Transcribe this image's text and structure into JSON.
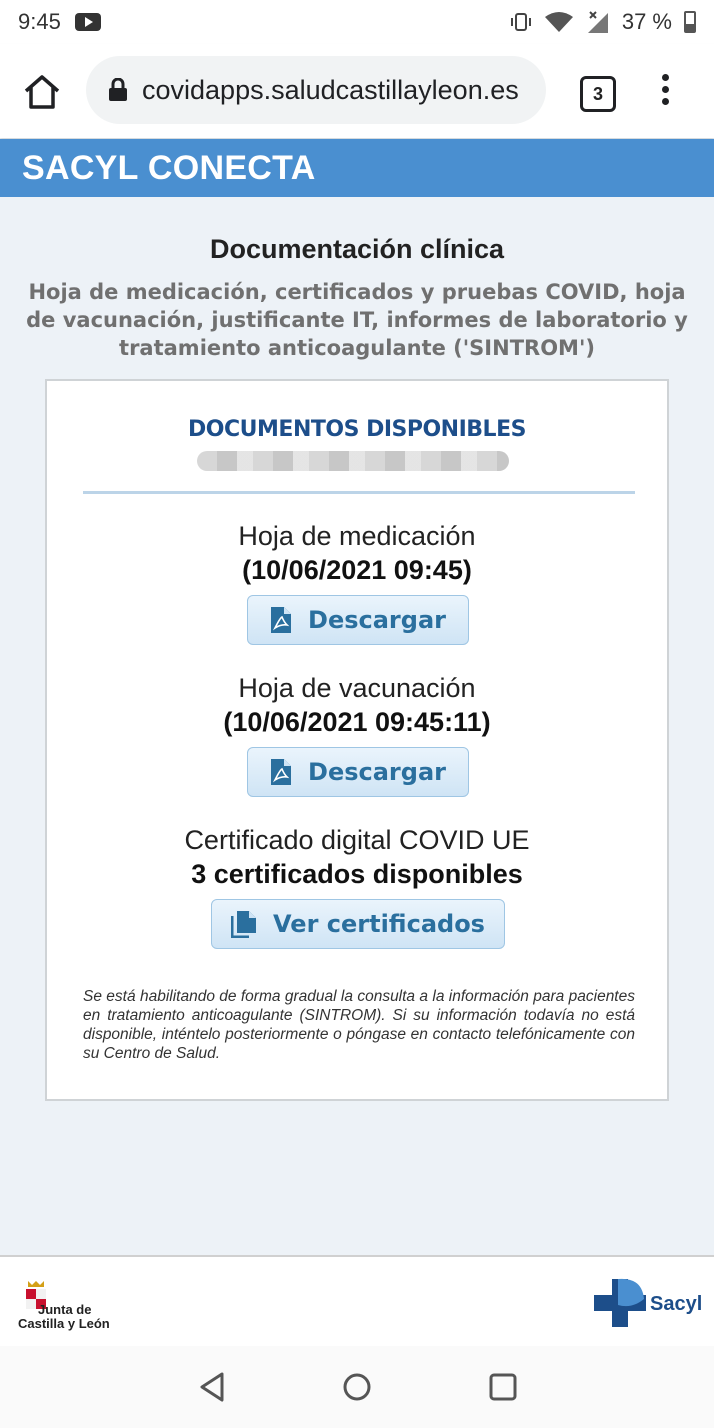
{
  "status_bar": {
    "time": "9:45",
    "battery": "37 %"
  },
  "browser": {
    "url": "covidapps.saludcastillayleon.es",
    "tab_count": "3"
  },
  "header": {
    "title": "SACYL CONECTA"
  },
  "page": {
    "title": "Documentación clínica",
    "subtitle": "Hoja de medicación, certificados y pruebas COVID, hoja de vacunación, justificante IT, informes de laboratorio y tratamiento anticoagulante ('SINTROM')"
  },
  "card": {
    "heading": "DOCUMENTOS DISPONIBLES",
    "items": [
      {
        "title": "Hoja de medicación",
        "detail": "(10/06/2021 09:45)",
        "button": "Descargar"
      },
      {
        "title": "Hoja de vacunación",
        "detail": "(10/06/2021 09:45:11)",
        "button": "Descargar"
      },
      {
        "title": "Certificado digital COVID UE",
        "detail": "3 certificados disponibles",
        "button": "Ver certificados"
      }
    ],
    "note": "Se está habilitando de forma gradual la consulta a la información para pacientes en tratamiento anticoagulante (SINTROM). Si su información todavía no está disponible, inténtelo posteriormente o póngase en contacto telefónicamente con su Centro de Salud."
  },
  "footer": {
    "left_logo": [
      "Junta de",
      "Castilla y León"
    ],
    "right_logo": "Sacyl"
  },
  "colors": {
    "header": "#4a8fd0",
    "heading": "#1d4e8a",
    "button_text": "#2a6f9e"
  }
}
